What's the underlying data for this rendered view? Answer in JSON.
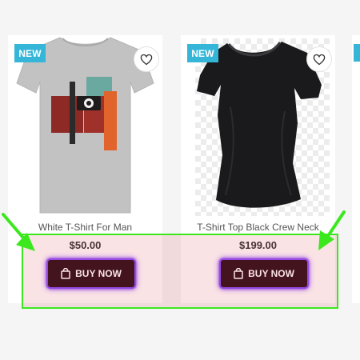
{
  "products": [
    {
      "badge": "NEW",
      "title": "White T-Shirt For Man",
      "price": "$50.00",
      "button_label": "BUY NOW",
      "image_icon": "grey-tshirt-with-camera-print"
    },
    {
      "badge": "NEW",
      "title": "T-Shirt Top Black Crew Neck",
      "price": "$199.00",
      "button_label": "BUY NOW",
      "image_icon": "black-womens-tshirt"
    }
  ],
  "icons": {
    "wishlist": "heart-outline-icon",
    "buy": "shopping-bag-icon"
  },
  "annotation": {
    "color": "#3be81e",
    "shape": "highlight-box-with-arrows"
  },
  "colors": {
    "badge": "#35b6d8",
    "button_bg": "#2a0d18",
    "button_glow": "#8a4dff",
    "page_bg": "#f5f5f5"
  }
}
